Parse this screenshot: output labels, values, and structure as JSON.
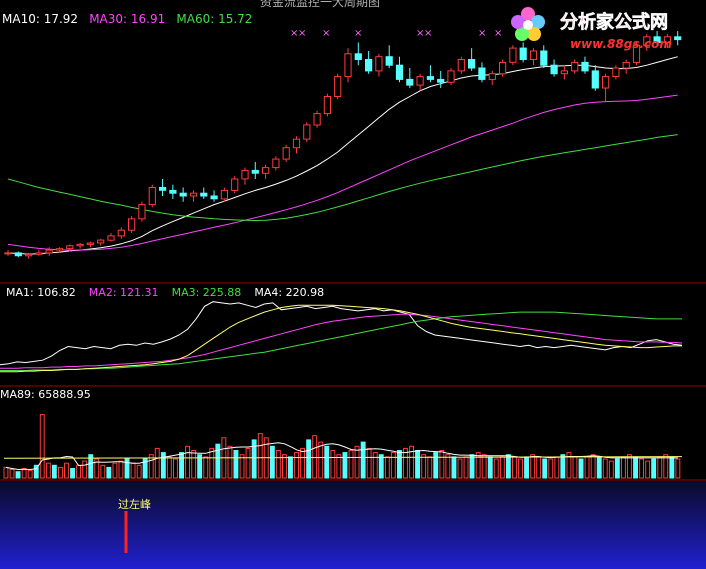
{
  "title": "资金流监控一大周期图",
  "logo": {
    "name": "分析家公式网",
    "url": "www.88gs.com"
  },
  "colors": {
    "background": "#000000",
    "up": "#ff3b3b",
    "down": "#55ffff",
    "white": "#ffffff",
    "yellow": "#ffff66",
    "magenta": "#ff44ff",
    "green": "#44dd44",
    "grid": "#a00000",
    "marker": "#ff66ff"
  },
  "panels": {
    "price": {
      "legend": [
        {
          "label": "MA10: 17.92",
          "color": "#ffffff"
        },
        {
          "label": "MA30: 16.91",
          "color": "#ff44ff"
        },
        {
          "label": "MA60: 15.72",
          "color": "#44dd44"
        }
      ],
      "markers": [
        "×",
        "×",
        "×",
        "×",
        "×",
        "×",
        "×",
        "×",
        "×"
      ]
    },
    "indicator": {
      "legend": [
        {
          "label": "MA1: 106.82",
          "color": "#ffffff"
        },
        {
          "label": "MA2: 121.31",
          "color": "#ff44ff"
        },
        {
          "label": "MA3: 225.88",
          "color": "#44dd44"
        },
        {
          "label": "MA4: 220.98",
          "color": "#ffffff"
        }
      ]
    },
    "volume": {
      "legend": [
        {
          "label": "MA89: 65888.95",
          "color": "#ffffff"
        }
      ]
    },
    "signal": {
      "label": "过左峰"
    }
  },
  "chart_data": [
    {
      "type": "candlestick",
      "series_up_down": "red=up, cyan=down",
      "candles": [
        [
          11.6,
          11.7,
          11.5,
          11.6
        ],
        [
          11.6,
          11.65,
          11.45,
          11.5
        ],
        [
          11.5,
          11.6,
          11.4,
          11.55
        ],
        [
          11.55,
          11.7,
          11.5,
          11.6
        ],
        [
          11.6,
          11.8,
          11.5,
          11.7
        ],
        [
          11.7,
          11.8,
          11.6,
          11.75
        ],
        [
          11.75,
          11.9,
          11.65,
          11.85
        ],
        [
          11.85,
          11.95,
          11.75,
          11.9
        ],
        [
          11.9,
          12.0,
          11.8,
          11.95
        ],
        [
          11.95,
          12.1,
          11.85,
          12.05
        ],
        [
          12.05,
          12.3,
          12.0,
          12.2
        ],
        [
          12.2,
          12.5,
          12.1,
          12.4
        ],
        [
          12.4,
          12.9,
          12.3,
          12.8
        ],
        [
          12.8,
          13.4,
          12.7,
          13.3
        ],
        [
          13.3,
          14.0,
          13.2,
          13.9
        ],
        [
          13.9,
          14.2,
          13.6,
          13.8
        ],
        [
          13.8,
          14.0,
          13.5,
          13.7
        ],
        [
          13.7,
          13.9,
          13.4,
          13.6
        ],
        [
          13.6,
          13.8,
          13.4,
          13.7
        ],
        [
          13.7,
          13.9,
          13.5,
          13.6
        ],
        [
          13.6,
          13.8,
          13.4,
          13.5
        ],
        [
          13.5,
          13.9,
          13.4,
          13.8
        ],
        [
          13.8,
          14.3,
          13.7,
          14.2
        ],
        [
          14.2,
          14.6,
          14.0,
          14.5
        ],
        [
          14.5,
          14.8,
          14.2,
          14.4
        ],
        [
          14.4,
          14.7,
          14.2,
          14.6
        ],
        [
          14.6,
          15.0,
          14.5,
          14.9
        ],
        [
          14.9,
          15.4,
          14.8,
          15.3
        ],
        [
          15.3,
          15.7,
          15.1,
          15.6
        ],
        [
          15.6,
          16.2,
          15.5,
          16.1
        ],
        [
          16.1,
          16.6,
          16.0,
          16.5
        ],
        [
          16.5,
          17.2,
          16.4,
          17.1
        ],
        [
          17.1,
          17.9,
          17.0,
          17.8
        ],
        [
          17.8,
          18.8,
          17.6,
          18.6
        ],
        [
          18.6,
          19.0,
          18.2,
          18.4
        ],
        [
          18.4,
          18.7,
          17.9,
          18.0
        ],
        [
          18.0,
          18.6,
          17.8,
          18.5
        ],
        [
          18.5,
          18.9,
          18.1,
          18.2
        ],
        [
          18.2,
          18.5,
          17.6,
          17.7
        ],
        [
          17.7,
          18.1,
          17.4,
          17.5
        ],
        [
          17.5,
          17.9,
          17.3,
          17.8
        ],
        [
          17.8,
          18.2,
          17.6,
          17.7
        ],
        [
          17.7,
          18.0,
          17.4,
          17.6
        ],
        [
          17.6,
          18.1,
          17.5,
          18.0
        ],
        [
          18.0,
          18.5,
          17.9,
          18.4
        ],
        [
          18.4,
          18.8,
          18.0,
          18.1
        ],
        [
          18.1,
          18.3,
          17.6,
          17.7
        ],
        [
          17.7,
          18.0,
          17.5,
          17.9
        ],
        [
          17.9,
          18.4,
          17.8,
          18.3
        ],
        [
          18.3,
          18.9,
          18.2,
          18.8
        ],
        [
          18.8,
          19.0,
          18.3,
          18.4
        ],
        [
          18.4,
          18.8,
          18.2,
          18.7
        ],
        [
          18.7,
          18.9,
          18.1,
          18.2
        ],
        [
          18.2,
          18.4,
          17.8,
          17.9
        ],
        [
          17.9,
          18.2,
          17.7,
          18.0
        ],
        [
          18.0,
          18.4,
          17.9,
          18.3
        ],
        [
          18.3,
          18.5,
          17.9,
          18.0
        ],
        [
          18.0,
          18.2,
          17.3,
          17.4
        ],
        [
          17.4,
          17.9,
          16.9,
          17.8
        ],
        [
          17.8,
          18.2,
          17.7,
          18.1
        ],
        [
          18.1,
          18.4,
          17.9,
          18.3
        ],
        [
          18.3,
          19.0,
          18.2,
          18.9
        ],
        [
          18.9,
          19.3,
          18.7,
          19.2
        ],
        [
          19.2,
          19.4,
          18.9,
          19.0
        ],
        [
          19.0,
          19.3,
          18.8,
          19.2
        ],
        [
          19.2,
          19.4,
          18.9,
          19.1
        ]
      ],
      "ma": [
        {
          "name": "MA10",
          "color": "#ffffff",
          "values": [
            11.6,
            11.58,
            11.56,
            11.57,
            11.6,
            11.63,
            11.67,
            11.7,
            11.74,
            11.78,
            11.84,
            11.92,
            12.03,
            12.18,
            12.38,
            12.55,
            12.7,
            12.85,
            13.0,
            13.15,
            13.3,
            13.42,
            13.55,
            13.68,
            13.8,
            13.9,
            14.02,
            14.15,
            14.3,
            14.48,
            14.67,
            14.9,
            15.15,
            15.45,
            15.75,
            16.05,
            16.35,
            16.65,
            16.9,
            17.1,
            17.3,
            17.45,
            17.55,
            17.65,
            17.75,
            17.82,
            17.85,
            17.87,
            17.9,
            17.98,
            18.05,
            18.1,
            18.15,
            18.17,
            18.18,
            18.2,
            18.2,
            18.15,
            18.1,
            18.08,
            18.08,
            18.12,
            18.2,
            18.3,
            18.4,
            18.5
          ]
        },
        {
          "name": "MA30",
          "color": "#ff44ff",
          "values": [
            11.9,
            11.85,
            11.8,
            11.76,
            11.73,
            11.71,
            11.7,
            11.7,
            11.71,
            11.73,
            11.76,
            11.8,
            11.86,
            11.93,
            12.02,
            12.1,
            12.18,
            12.26,
            12.34,
            12.42,
            12.5,
            12.58,
            12.66,
            12.75,
            12.84,
            12.93,
            13.02,
            13.12,
            13.22,
            13.33,
            13.45,
            13.58,
            13.72,
            13.88,
            14.04,
            14.2,
            14.36,
            14.52,
            14.68,
            14.84,
            14.98,
            15.12,
            15.26,
            15.4,
            15.54,
            15.68,
            15.8,
            15.92,
            16.04,
            16.16,
            16.3,
            16.42,
            16.54,
            16.64,
            16.72,
            16.8,
            16.86,
            16.9,
            16.92,
            16.93,
            16.94,
            16.96,
            17.0,
            17.05,
            17.1,
            17.15
          ]
        },
        {
          "name": "MA60",
          "color": "#44dd44",
          "values": [
            14.2,
            14.1,
            14.0,
            13.9,
            13.82,
            13.74,
            13.66,
            13.58,
            13.5,
            13.42,
            13.35,
            13.28,
            13.2,
            13.13,
            13.06,
            13.0,
            12.94,
            12.9,
            12.86,
            12.83,
            12.8,
            12.78,
            12.76,
            12.75,
            12.74,
            12.75,
            12.78,
            12.82,
            12.88,
            12.95,
            13.03,
            13.12,
            13.22,
            13.32,
            13.43,
            13.54,
            13.65,
            13.76,
            13.86,
            13.96,
            14.05,
            14.14,
            14.22,
            14.3,
            14.38,
            14.46,
            14.54,
            14.62,
            14.7,
            14.78,
            14.86,
            14.93,
            15.0,
            15.06,
            15.12,
            15.18,
            15.24,
            15.3,
            15.36,
            15.42,
            15.48,
            15.54,
            15.6,
            15.66,
            15.71,
            15.76
          ]
        }
      ],
      "ylim": [
        11.0,
        20.0
      ]
    },
    {
      "type": "line",
      "series": [
        {
          "name": "MA1",
          "color": "#ffffff",
          "values": [
            30,
            32,
            35,
            34,
            36,
            38,
            45,
            55,
            62,
            60,
            58,
            62,
            60,
            58,
            64,
            66,
            64,
            68,
            66,
            70,
            75,
            82,
            92,
            110,
            132,
            140,
            138,
            136,
            138,
            134,
            130,
            136,
            138,
            126,
            128,
            130,
            132,
            128,
            130,
            132,
            128,
            126,
            124,
            126,
            128,
            124,
            126,
            122,
            118,
            98,
            88,
            82,
            80,
            78,
            76,
            74,
            72,
            70,
            68,
            66,
            64,
            62,
            64,
            60,
            62,
            60,
            62,
            64,
            62,
            60,
            58,
            56,
            60,
            62,
            60,
            66,
            72,
            74,
            70,
            66,
            64
          ]
        },
        {
          "name": "MA2",
          "color": "#ff44ff",
          "values": [
            24,
            24,
            24,
            25,
            25,
            25,
            26,
            26,
            27,
            27,
            28,
            28,
            29,
            30,
            31,
            32,
            33,
            34,
            35,
            36,
            38,
            40,
            42,
            45,
            48,
            52,
            56,
            60,
            64,
            68,
            72,
            76,
            80,
            84,
            88,
            92,
            96,
            100,
            103,
            106,
            108,
            110,
            112,
            114,
            115,
            116,
            117,
            118,
            118,
            117,
            116,
            114,
            112,
            110,
            108,
            106,
            104,
            102,
            100,
            98,
            96,
            94,
            92,
            90,
            88,
            86,
            84,
            82,
            80,
            78,
            76,
            74,
            73,
            72,
            71,
            70,
            70,
            70,
            69,
            69,
            68
          ]
        },
        {
          "name": "MA3",
          "color": "#44dd44",
          "values": [
            20,
            20,
            20,
            20,
            21,
            21,
            21,
            22,
            22,
            22,
            23,
            23,
            24,
            24,
            25,
            26,
            27,
            28,
            29,
            30,
            31,
            32,
            34,
            36,
            38,
            40,
            42,
            44,
            46,
            48,
            50,
            52,
            55,
            58,
            61,
            64,
            67,
            70,
            73,
            76,
            79,
            82,
            85,
            88,
            91,
            94,
            97,
            100,
            103,
            106,
            108,
            110,
            112,
            114,
            115,
            116,
            117,
            118,
            119,
            120,
            121,
            122,
            122,
            122,
            122,
            122,
            121,
            120,
            119,
            118,
            117,
            116,
            115,
            114,
            113,
            112,
            111,
            110,
            110,
            110,
            110
          ]
        },
        {
          "name": "MA4",
          "color": "#ffff66",
          "values": [
            18,
            18,
            18,
            19,
            19,
            20,
            20,
            21,
            22,
            22,
            23,
            24,
            25,
            26,
            27,
            28,
            29,
            30,
            32,
            34,
            36,
            40,
            46,
            56,
            66,
            76,
            86,
            96,
            104,
            110,
            116,
            122,
            126,
            130,
            132,
            134,
            134,
            134,
            134,
            134,
            133,
            132,
            131,
            130,
            129,
            128,
            126,
            124,
            121,
            118,
            114,
            110,
            106,
            102,
            99,
            96,
            94,
            92,
            90,
            88,
            86,
            84,
            82,
            80,
            78,
            76,
            74,
            72,
            70,
            68,
            66,
            64,
            63,
            62,
            61,
            60,
            60,
            61,
            62,
            63,
            63
          ]
        }
      ],
      "ylim": [
        0,
        150
      ]
    },
    {
      "type": "bar",
      "values": [
        10,
        8,
        6,
        9,
        7,
        12,
        60,
        14,
        12,
        10,
        14,
        9,
        12,
        16,
        22,
        18,
        12,
        10,
        14,
        16,
        18,
        14,
        12,
        18,
        22,
        28,
        24,
        20,
        18,
        24,
        30,
        26,
        22,
        20,
        28,
        32,
        38,
        30,
        26,
        22,
        28,
        36,
        42,
        38,
        30,
        26,
        22,
        20,
        24,
        28,
        36,
        40,
        34,
        30,
        26,
        22,
        24,
        26,
        30,
        34,
        28,
        24,
        22,
        20,
        24,
        26,
        28,
        30,
        26,
        22,
        20,
        24,
        26,
        22,
        20,
        18,
        20,
        22,
        24,
        22,
        20,
        18,
        20,
        22,
        20,
        18,
        20,
        22,
        20,
        18,
        18,
        20,
        22,
        24,
        20,
        18,
        20,
        22,
        20,
        18,
        16,
        18,
        20,
        22,
        20,
        18,
        16,
        18,
        20,
        22,
        20,
        18
      ],
      "colors": "alternating red (up) and cyan (down)",
      "ma": {
        "name": "MA89",
        "color": "#ffff66"
      },
      "ylim": [
        0,
        70
      ]
    }
  ]
}
